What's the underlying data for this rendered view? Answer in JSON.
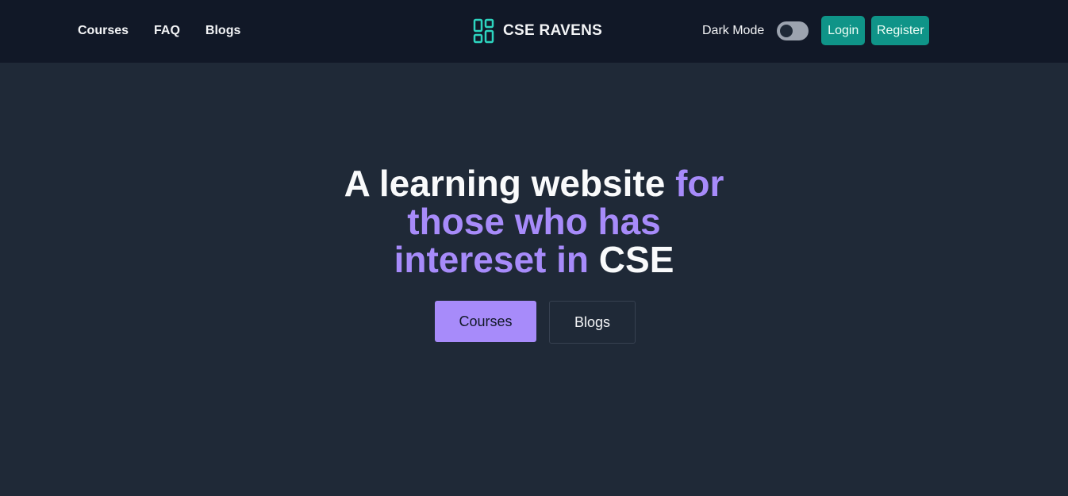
{
  "nav": {
    "links": [
      "Courses",
      "FAQ",
      "Blogs"
    ]
  },
  "brand": {
    "name": "CSE RAVENS",
    "icon": "dashboard-grid-icon",
    "icon_color": "#2dd4bf"
  },
  "tools": {
    "dark_mode_label": "Dark Mode",
    "login_label": "Login",
    "register_label": "Register"
  },
  "hero": {
    "title_part1": "A learning website ",
    "title_part2": "for those who has intereset in",
    "title_part3": " CSE",
    "primary_button": "Courses",
    "secondary_button": "Blogs"
  },
  "colors": {
    "navbar_bg": "#111827",
    "page_bg": "#1f2937",
    "accent": "#a78bfa",
    "teal": "#0f9488"
  }
}
